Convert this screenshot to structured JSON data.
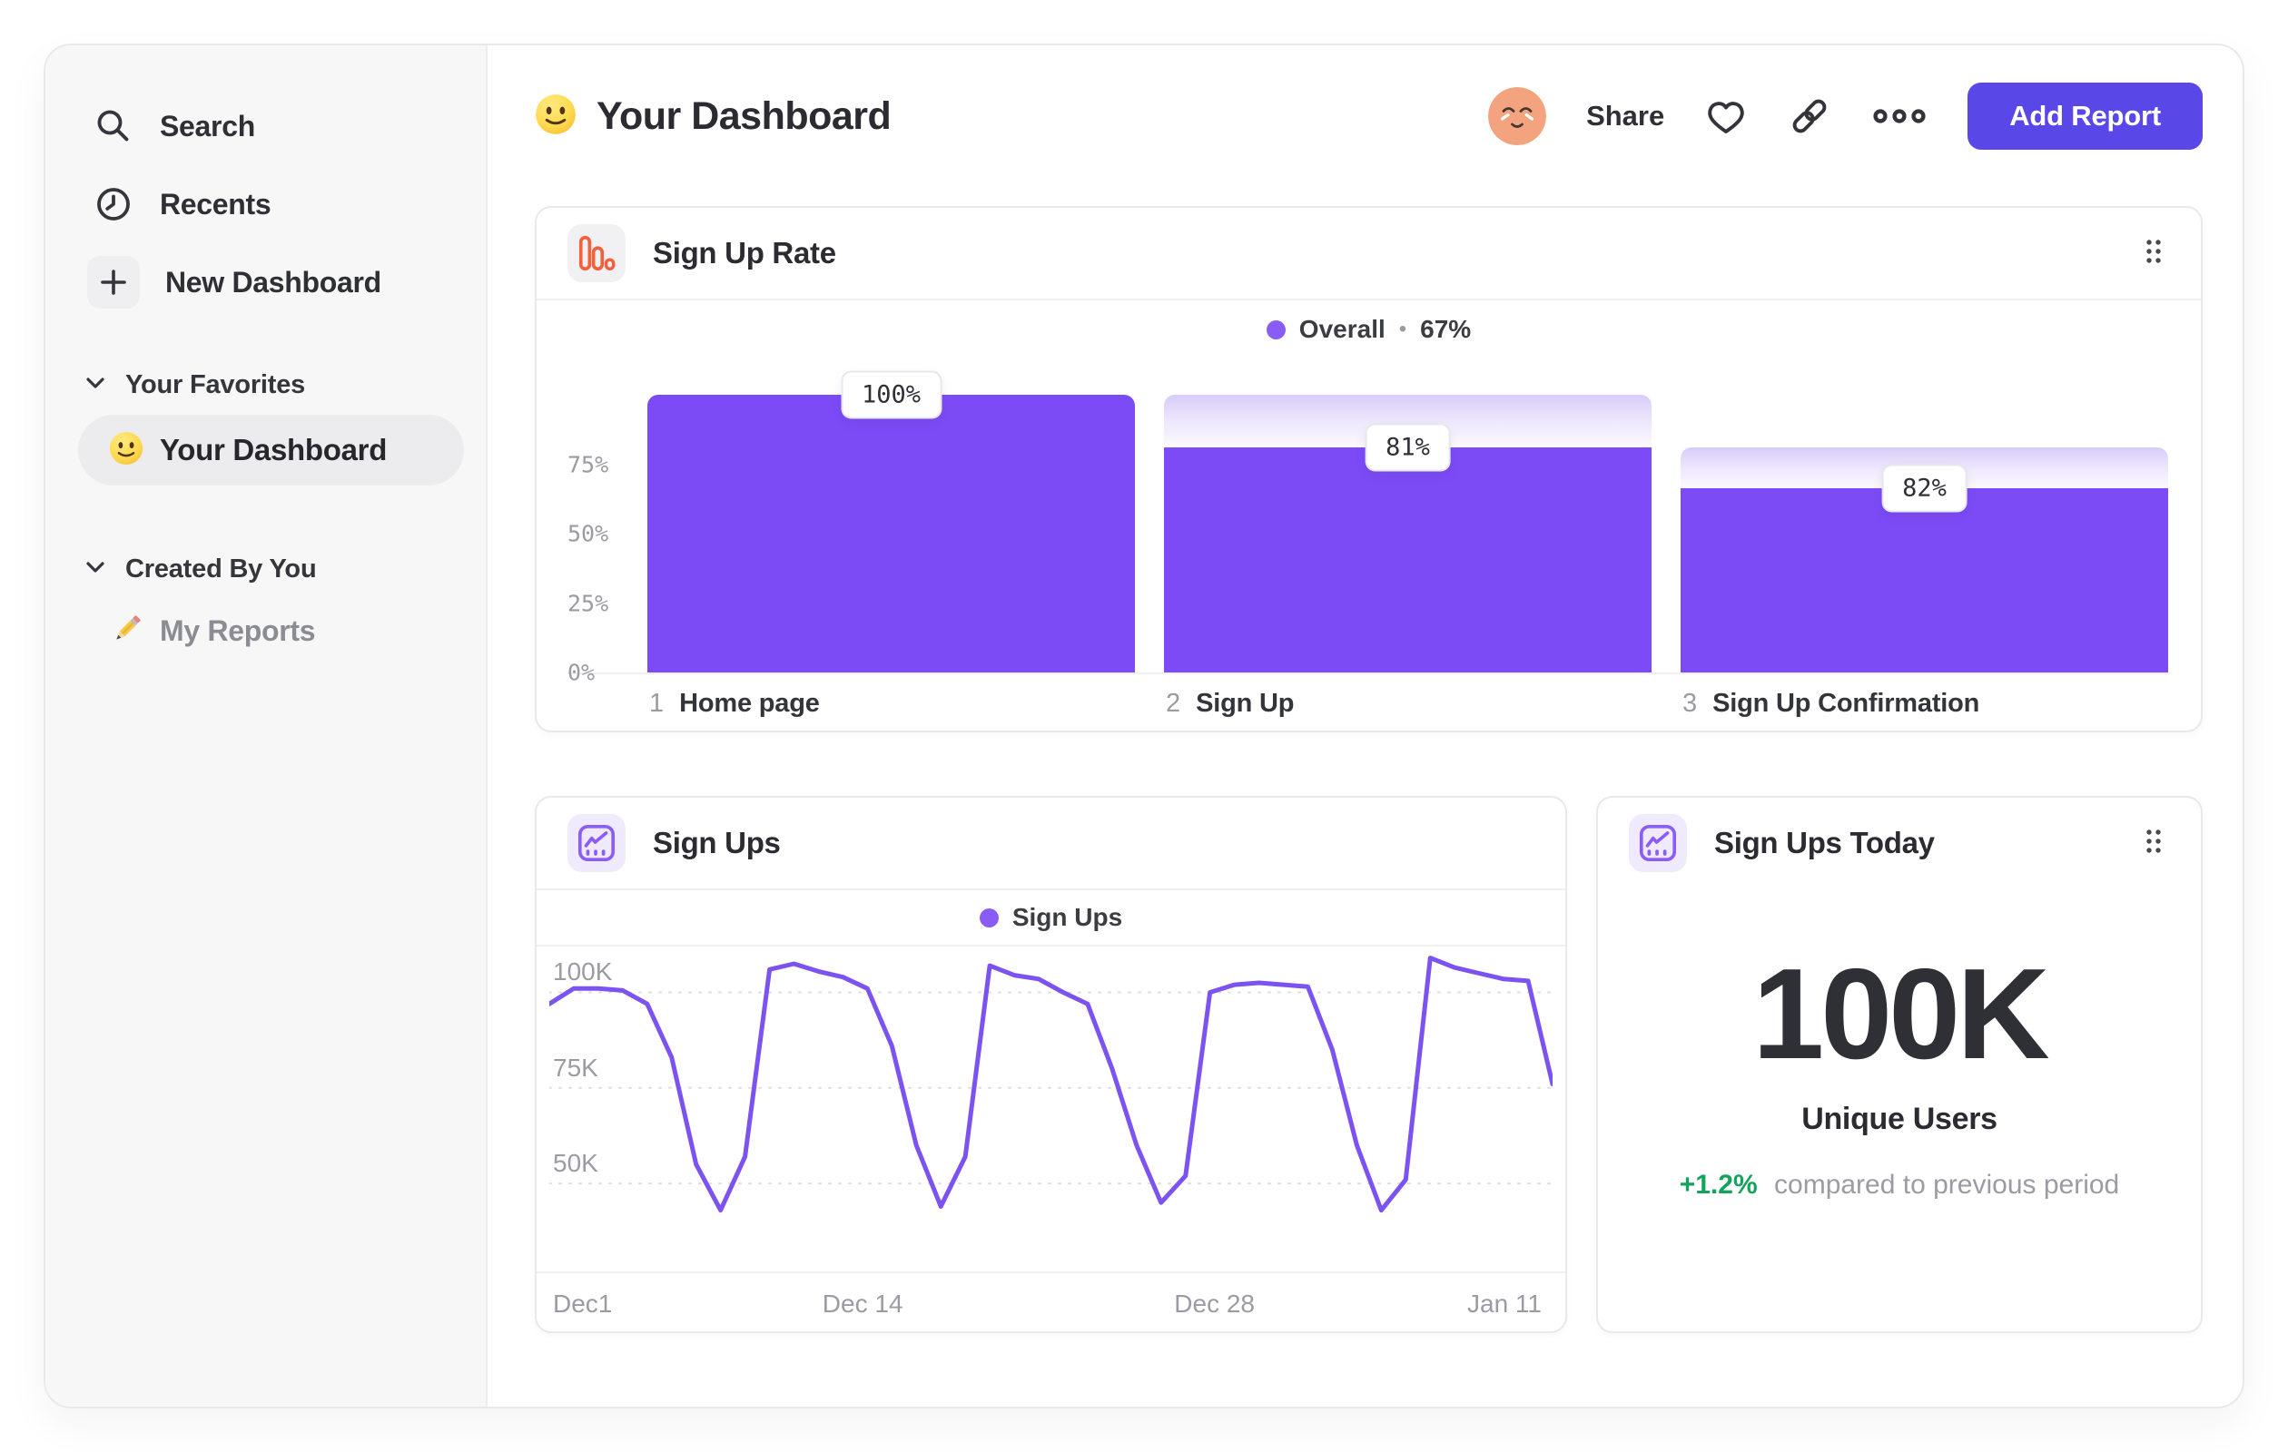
{
  "sidebar": {
    "nav": [
      {
        "label": "Search",
        "icon": "search-icon"
      },
      {
        "label": "Recents",
        "icon": "clock-icon"
      },
      {
        "label": "New Dashboard",
        "icon": "plus-icon"
      }
    ],
    "sections": [
      {
        "title": "Your Favorites",
        "items": [
          {
            "label": "Your Dashboard",
            "icon": "smiley-emoji",
            "active": true
          }
        ]
      },
      {
        "title": "Created By You",
        "items": [
          {
            "label": "My Reports",
            "icon": "pencil-emoji",
            "active": false
          }
        ]
      }
    ]
  },
  "header": {
    "title": "Your Dashboard",
    "title_icon": "smiley-emoji",
    "share": "Share",
    "add_report": "Add Report",
    "icons": [
      "avatar-face",
      "heart-icon",
      "link-icon",
      "ellipsis-icon"
    ]
  },
  "cards": {
    "funnel": {
      "title": "Sign Up Rate",
      "icon": "bar-chart-icon",
      "legend_name": "Overall",
      "legend_sep": "•",
      "legend_value": "67%",
      "y_ticks": [
        "75%",
        "50%",
        "25%",
        "0%"
      ],
      "steps": [
        {
          "num": "1",
          "label": "Home page",
          "value": "100%"
        },
        {
          "num": "2",
          "label": "Sign Up",
          "value": "81%"
        },
        {
          "num": "3",
          "label": "Sign Up Confirmation",
          "value": "82%"
        }
      ]
    },
    "line": {
      "title": "Sign Ups",
      "icon": "line-chart-icon",
      "legend": "Sign Ups",
      "y_ticks": [
        "100K",
        "75K",
        "50K"
      ],
      "x_ticks": [
        "Dec1",
        "Dec 14",
        "Dec 28",
        "Jan 11"
      ]
    },
    "metric": {
      "title": "Sign Ups Today",
      "icon": "line-chart-icon",
      "value": "100K",
      "label": "Unique Users",
      "delta": "+1.2%",
      "note": "compared to previous period"
    }
  },
  "chart_data": [
    {
      "type": "bar",
      "variant": "funnel",
      "title": "Sign Up Rate",
      "legend": {
        "series": "Overall",
        "overall_conversion_pct": 67
      },
      "categories": [
        "Home page",
        "Sign Up",
        "Sign Up Confirmation"
      ],
      "step_conversion_pct": [
        100,
        81,
        82
      ],
      "absolute_pct": [
        100,
        81,
        66.4
      ],
      "value_labels": [
        "100%",
        "81%",
        "82%"
      ],
      "ylim": [
        0,
        100
      ],
      "y_ticks_pct": [
        0,
        25,
        50,
        75
      ],
      "bar_color": "#7C4BF6",
      "cap_gradient": [
        "#D8CCFA",
        "#FBF9FF"
      ]
    },
    {
      "type": "line",
      "title": "Sign Ups",
      "series": [
        {
          "name": "Sign Ups",
          "values_k": [
            97,
            101,
            101,
            100.5,
            97,
            83,
            55,
            43,
            57,
            106,
            107.5,
            105.5,
            104,
            101,
            86,
            60,
            44,
            57,
            107,
            104.5,
            103.5,
            100,
            97,
            80,
            60,
            45,
            52,
            100,
            102,
            102.5,
            102,
            101.5,
            85,
            60,
            43,
            51,
            109,
            106.5,
            105,
            103.5,
            103,
            76
          ]
        }
      ],
      "x_tick_labels": [
        "Dec1",
        "Dec 14",
        "Dec 28",
        "Jan 11"
      ],
      "x_tick_day_index": [
        0,
        13,
        27,
        41
      ],
      "y_tick_values_k": [
        100,
        75,
        50
      ],
      "ylim_k": [
        27,
        112
      ],
      "grid": "dashed-horizontal",
      "line_color": "#7C52F0",
      "legend_position": "top-center"
    },
    {
      "type": "single_value",
      "title": "Sign Ups Today",
      "value": "100K",
      "metric": "Unique Users",
      "delta_pct": "+1.2%",
      "comparison": "compared to previous period",
      "delta_color": "#13A35C"
    }
  ],
  "colors": {
    "bar_purple": "#7C4BF6",
    "line_purple": "#7C52F0",
    "legend_violet": "#8A5CF6",
    "button_indigo": "#5A47E8",
    "funnel_icon_orange": "#F2603D",
    "delta_green": "#13A35C",
    "sidebar_bg": "#F7F7F7",
    "text_dark": "#2E2E34",
    "text_gray": "#9B9BA3"
  }
}
